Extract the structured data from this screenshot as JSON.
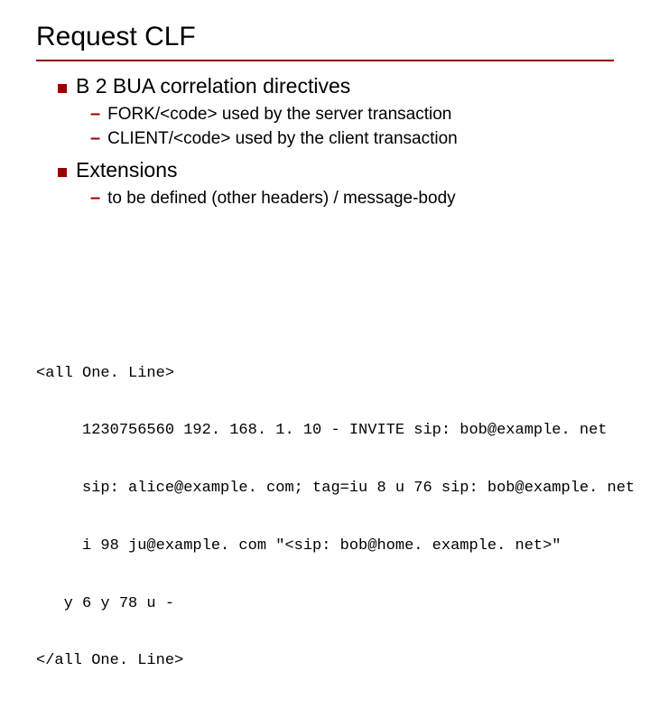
{
  "title": "Request CLF",
  "bullets": [
    {
      "text": "B 2 BUA correlation directives",
      "subs": [
        "FORK/<code>  used by the server transaction",
        "CLIENT/<code> used by the client transaction"
      ]
    },
    {
      "text": "Extensions",
      "subs": [
        "to be defined (other headers) / message-body"
      ]
    }
  ],
  "code_lines": [
    "<all One. Line>",
    "     1230756560 192. 168. 1. 10 - INVITE sip: bob@example. net",
    "     sip: alice@example. com; tag=iu 8 u 76 sip: bob@example. net",
    "     i 98 ju@example. com \"<sip: bob@home. example. net>\"",
    "   y 6 y 78 u -",
    "</all One. Line>"
  ]
}
